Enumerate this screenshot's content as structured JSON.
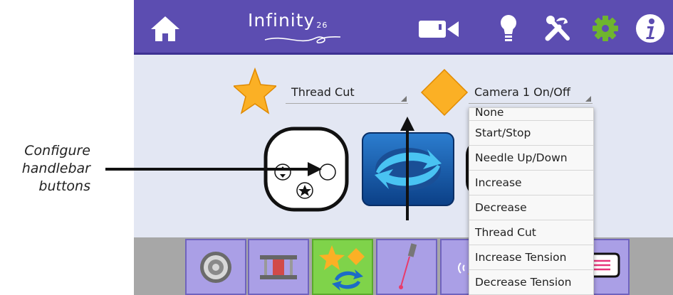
{
  "callout": {
    "lines": [
      "Configure",
      "handlebar",
      "buttons"
    ]
  },
  "header": {
    "brand": "Infinity",
    "brand_suffix": "26",
    "icons": [
      "home-icon",
      "video-camera-icon",
      "light-bulb-icon",
      "tools-icon",
      "gear-icon",
      "info-icon"
    ]
  },
  "config": {
    "slot1": {
      "icon": "star-icon",
      "value": "Thread Cut"
    },
    "slot2": {
      "icon": "diamond-icon",
      "value": "Camera 1 On/Off"
    }
  },
  "dropdown": {
    "options": [
      "None",
      "Start/Stop",
      "Needle Up/Down",
      "Increase",
      "Decrease",
      "Thread Cut",
      "Increase Tension",
      "Decrease Tension"
    ]
  },
  "bottom_tabs": [
    "bobbin-icon",
    "spool-icon",
    "handlebar-config-icon",
    "laser-icon",
    "sound-icon",
    "message-icon"
  ],
  "colors": {
    "header": "#5c4db1",
    "screen": "#e3e7f3",
    "tab": "#aa9fe6",
    "tab_active": "#7fd34a",
    "star": "#fbb025",
    "gear": "#6fb52e"
  }
}
